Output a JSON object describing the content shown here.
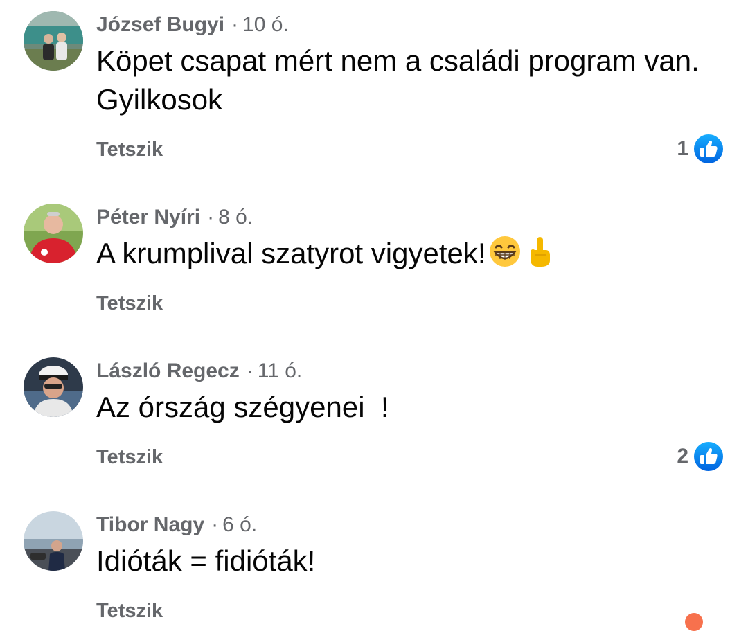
{
  "comments": [
    {
      "author": "József Bugyi",
      "time": "10 ó.",
      "text": "Köpet csapat mért nem a családi program van. Gyilkosok",
      "like_label": "Tetszik",
      "reaction_count": "1",
      "reaction_icon": "thumbs-up-icon"
    },
    {
      "author": "Péter Nyíri",
      "time": "8 ó.",
      "text": "A krumplival szatyrot vigyetek!",
      "emojis": [
        "grinning-face-icon",
        "middle-finger-icon"
      ],
      "like_label": "Tetszik"
    },
    {
      "author": "László Regecz",
      "time": "11 ó.",
      "text": "Az órszág szégyenei  !",
      "like_label": "Tetszik",
      "reaction_count": "2",
      "reaction_icon": "thumbs-up-icon"
    },
    {
      "author": "Tibor Nagy",
      "time": "6 ó.",
      "text": "Idióták = fidióták!",
      "like_label": "Tetszik",
      "reaction_icon": "reaction-icon"
    }
  ],
  "colors": {
    "like_blue": "#1877f2",
    "meta_gray": "#65676b",
    "text": "#050505",
    "partial_reaction": "#f7714d"
  },
  "separator": "·"
}
